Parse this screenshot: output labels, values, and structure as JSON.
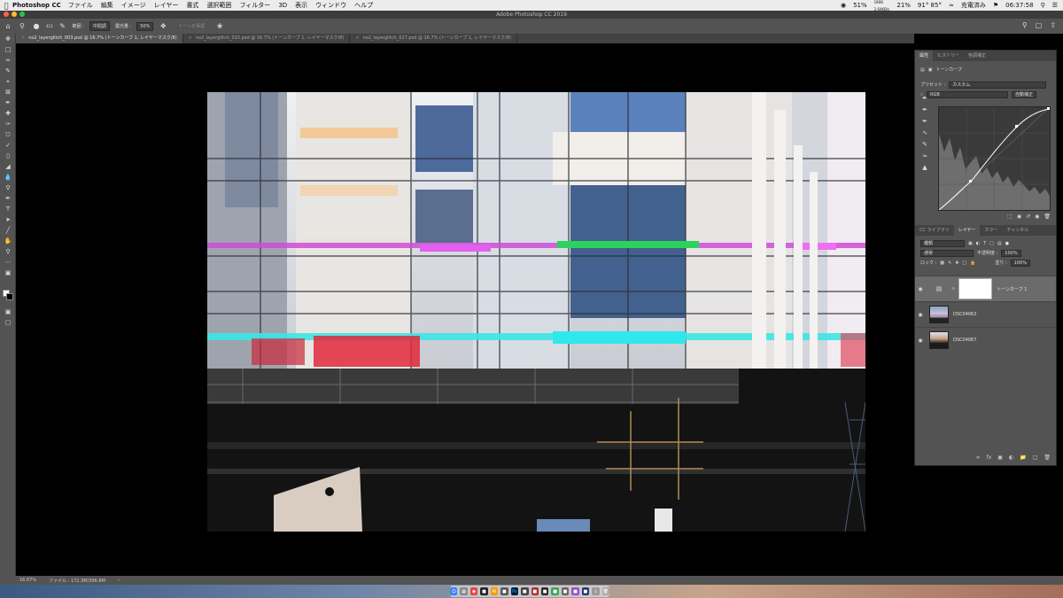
{
  "menubar": {
    "app_name": "Photoshop CC",
    "items": [
      "ファイル",
      "編集",
      "イメージ",
      "レイヤー",
      "書式",
      "選択範囲",
      "フィルター",
      "3D",
      "表示",
      "ウィンドウ",
      "ヘルプ"
    ],
    "status": {
      "battery_pct": "51%",
      "net_up": "1808",
      "net_down": "2.64KB/s",
      "cpu": "21%",
      "temp": "91° 85°",
      "charging": "充電済み",
      "clock": "06:37:58"
    }
  },
  "titlebar": {
    "title": "Adobe Photoshop CC 2019"
  },
  "options": {
    "brush_size": "412",
    "range_label": "範囲 :",
    "range_value": "中間調",
    "exposure_label": "露光量 :",
    "exposure_value": "50%",
    "protect_tones": "トーンを保護"
  },
  "tabs": [
    {
      "label": "no2_layerglitch_003.psd @ 16.7% (トーンカーブ 1, レイヤーマスク/8)",
      "active": true
    },
    {
      "label": "no2_layerglitch_015.psd @ 16.7% (トーンカーブ 1, レイヤーマスク/8)",
      "active": false
    },
    {
      "label": "no2_layerglitch_027.psd @ 16.7% (トーンカーブ 1, レイヤーマスク/8)",
      "active": false
    }
  ],
  "properties": {
    "tabs": [
      "属性",
      "ヒストリー",
      "色調補正"
    ],
    "title": "トーンカーブ",
    "preset_label": "プリセット :",
    "preset_value": "カスタム",
    "channel": "RGB",
    "auto": "自動補正"
  },
  "layers": {
    "tabs": [
      "CC ライブラリ",
      "レイヤー",
      "カラー",
      "チャンネル"
    ],
    "filter": "種類",
    "blend_mode": "通常",
    "opacity_label": "不透明度 :",
    "opacity": "100%",
    "lock_label": "ロック :",
    "fill_label": "塗り :",
    "fill": "100%",
    "items": [
      {
        "name": "トーンカーブ 1",
        "selected": true
      },
      {
        "name": "DSC04062",
        "selected": false
      },
      {
        "name": "DSC04067",
        "selected": false
      }
    ]
  },
  "status": {
    "zoom": "16.67%",
    "file": "ファイル : 172.3M/396.8M"
  },
  "colors": {
    "panel": "#535353",
    "panel_dark": "#424242",
    "menubar": "#ececec"
  }
}
